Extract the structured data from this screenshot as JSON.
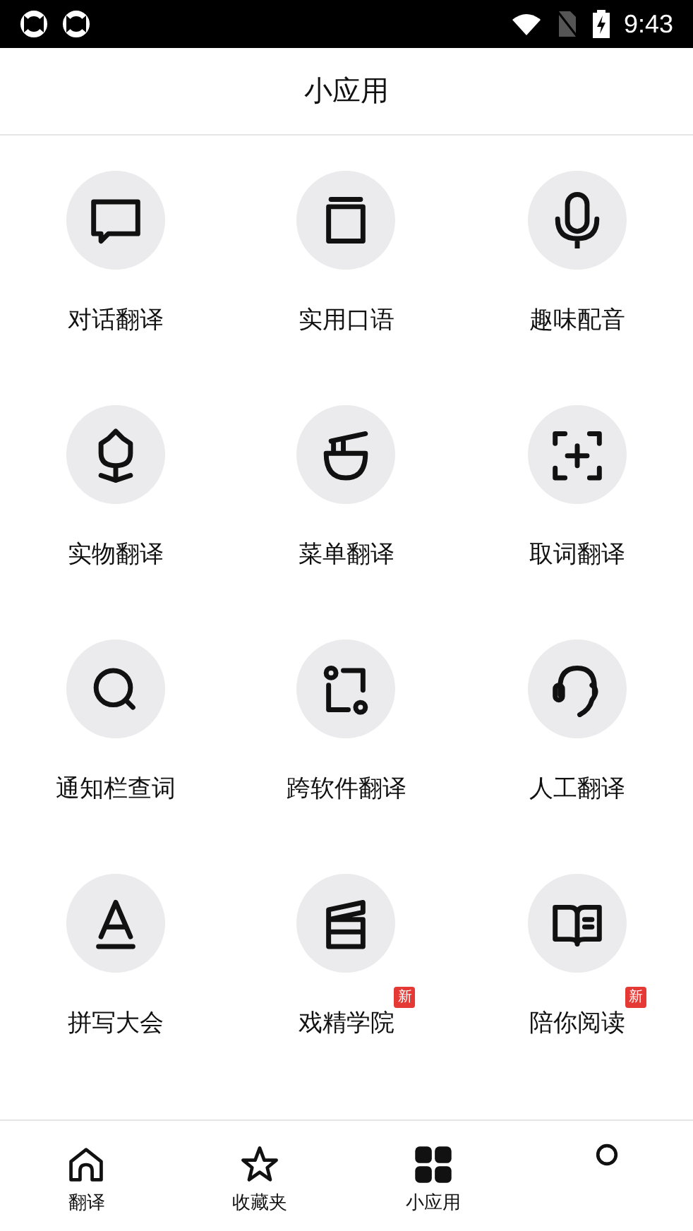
{
  "status_bar": {
    "time": "9:43"
  },
  "header": {
    "title": "小应用"
  },
  "apps": [
    {
      "label": "对话翻译"
    },
    {
      "label": "实用口语"
    },
    {
      "label": "趣味配音"
    },
    {
      "label": "实物翻译"
    },
    {
      "label": "菜单翻译"
    },
    {
      "label": "取词翻译"
    },
    {
      "label": "通知栏查词"
    },
    {
      "label": "跨软件翻译"
    },
    {
      "label": "人工翻译"
    },
    {
      "label": "拼写大会"
    },
    {
      "label": "戏精学院",
      "badge": "新"
    },
    {
      "label": "陪你阅读",
      "badge": "新"
    }
  ],
  "tabs": [
    {
      "label": "翻译",
      "selected": false
    },
    {
      "label": "收藏夹",
      "selected": false
    },
    {
      "label": "小应用",
      "selected": true
    },
    {
      "selected": false
    }
  ]
}
